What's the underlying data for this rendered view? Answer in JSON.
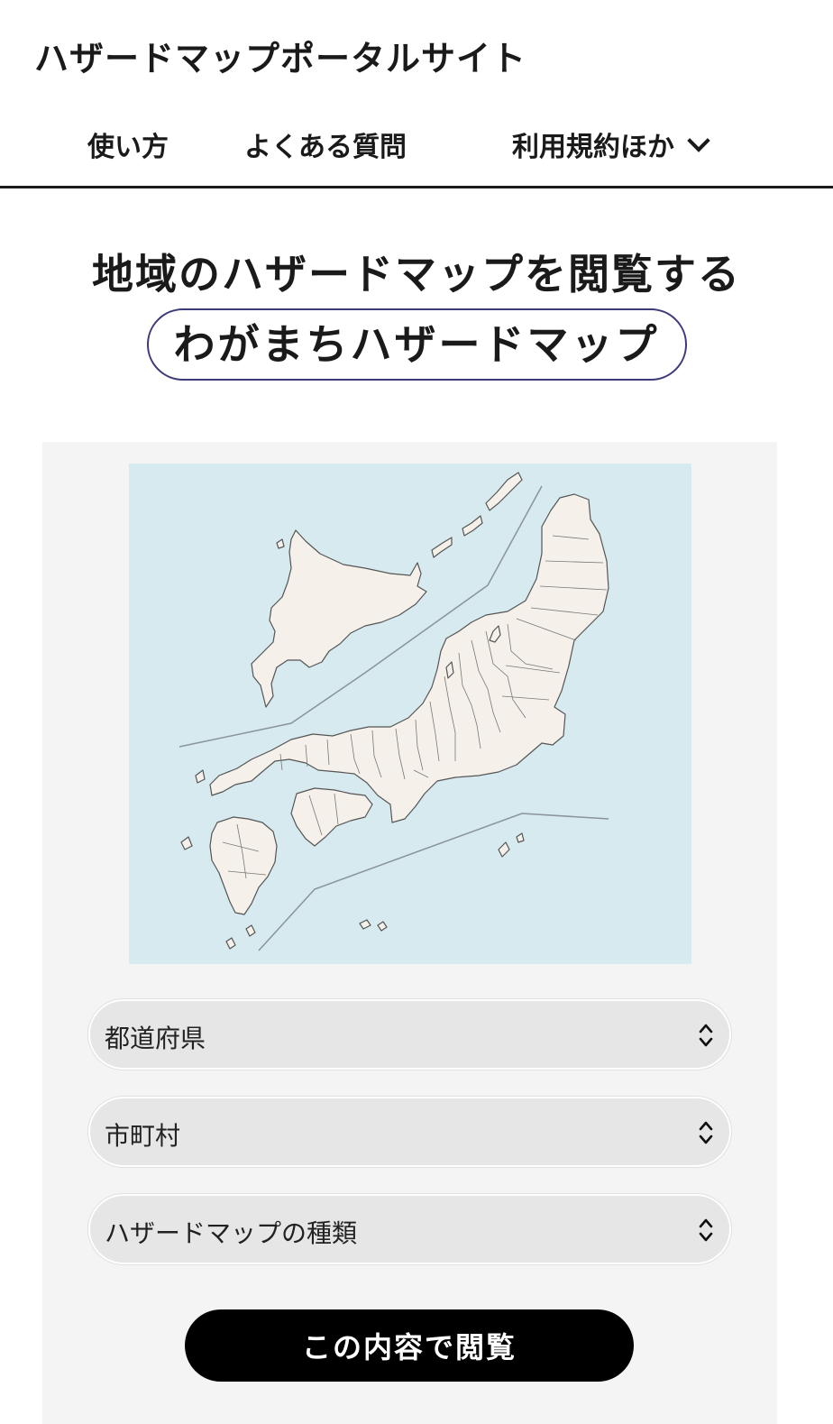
{
  "header": {
    "site_title": "ハザードマップポータルサイト",
    "nav": [
      {
        "label": "使い方"
      },
      {
        "label": "よくある質問"
      },
      {
        "label": "利用規約ほか",
        "icon": "chevron-down-icon"
      }
    ]
  },
  "hero": {
    "headline": "地域のハザードマップを閲覧する",
    "pill": "わがまちハザードマップ"
  },
  "form": {
    "prefecture_select": "都道府県",
    "municipality_select": "市町村",
    "hazard_type_select": "ハザードマップの種類",
    "submit_label": "この内容で閲覧"
  },
  "colors": {
    "sea": "#d6eaf0",
    "land": "#f5f1ea",
    "pill_border": "#3d3a7a",
    "panel_bg": "#f4f4f4",
    "button_bg": "#000000"
  }
}
